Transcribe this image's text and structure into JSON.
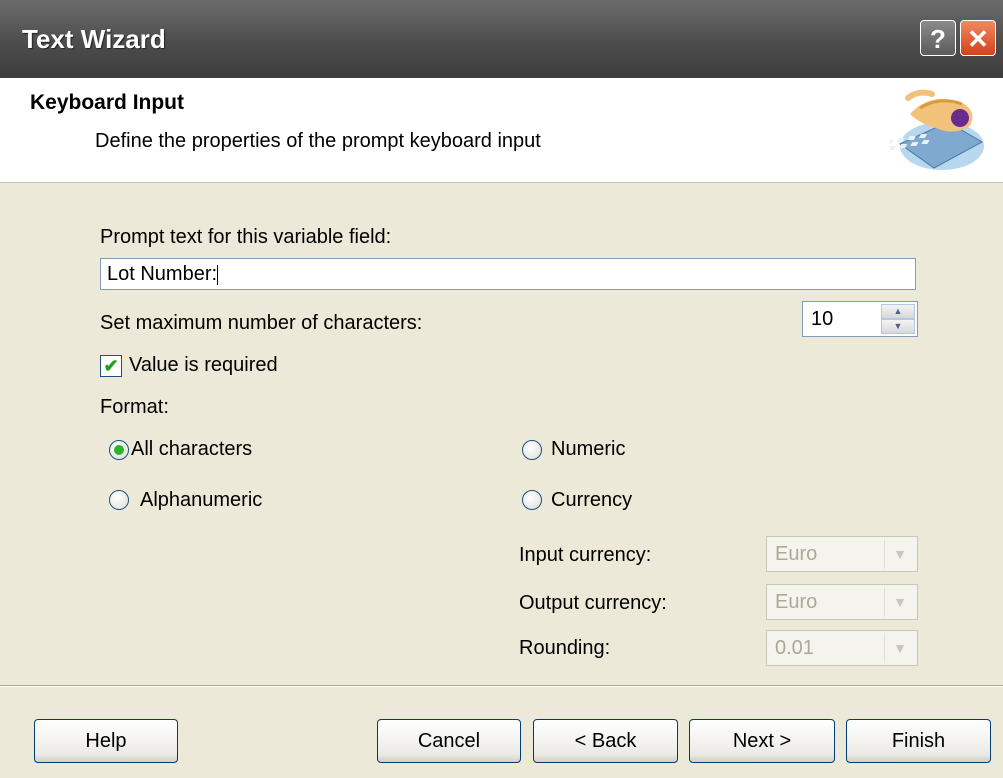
{
  "window": {
    "title": "Text Wizard",
    "help_glyph": "?",
    "close_glyph": "✕"
  },
  "header": {
    "title": "Keyboard Input",
    "subtitle": "Define the properties of the prompt keyboard input",
    "icon": "keyboard-hand-icon"
  },
  "form": {
    "prompt_label": "Prompt text for this variable field:",
    "prompt_value": "Lot Number:",
    "max_chars_label": "Set maximum number of characters:",
    "max_chars_value": "10",
    "required_label": "Value is required",
    "required_checked": true,
    "format_label": "Format:",
    "format_options": [
      {
        "label": "All characters",
        "selected": true
      },
      {
        "label": "Numeric",
        "selected": false
      },
      {
        "label": "Alphanumeric",
        "selected": false
      },
      {
        "label": "Currency",
        "selected": false
      }
    ],
    "input_currency_label": "Input currency:",
    "input_currency_value": "Euro",
    "output_currency_label": "Output currency:",
    "output_currency_value": "Euro",
    "rounding_label": "Rounding:",
    "rounding_value": "0.01"
  },
  "buttons": {
    "help": "Help",
    "cancel": "Cancel",
    "back": "< Back",
    "next": "Next >",
    "finish": "Finish"
  },
  "colors": {
    "dialog_bg": "#ece9d8",
    "titlebar": "#4d4d4d",
    "close_button": "#d5401c",
    "check_green": "#21a121"
  }
}
